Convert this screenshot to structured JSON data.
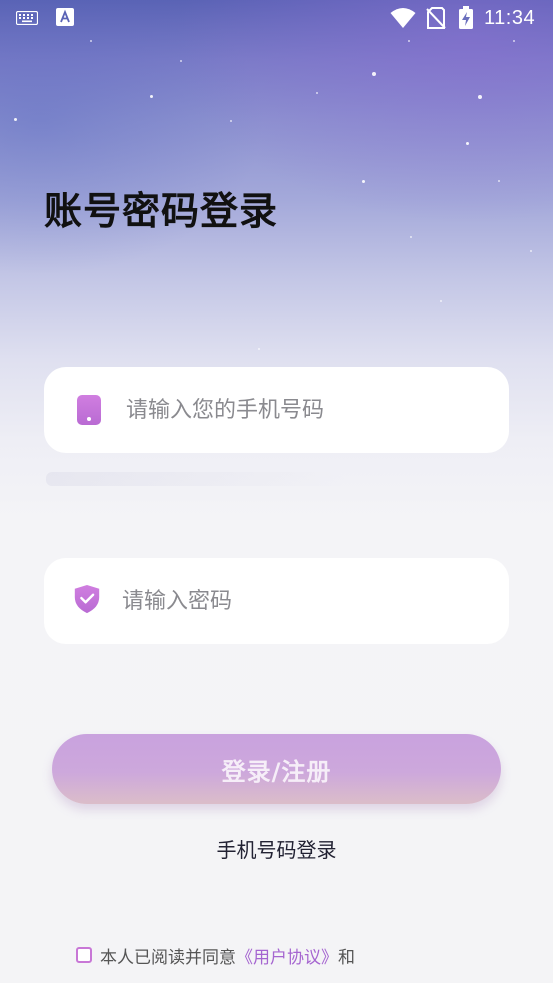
{
  "status_bar": {
    "time": "11:34"
  },
  "page": {
    "title": "账号密码登录"
  },
  "form": {
    "phone_placeholder": "请输入您的手机号码",
    "password_placeholder": "请输入密码",
    "submit_label": "登录/注册",
    "switch_link": "手机号码登录"
  },
  "agreement": {
    "prefix": "本人已阅读并同意",
    "user_agreement_link": "《用户协议》",
    "conjunction": "和"
  },
  "colors": {
    "accent": "#c877d6",
    "link": "#a565d0",
    "button_gradient_top": "#c9a2de",
    "button_gradient_bottom": "#dbbdc9"
  },
  "icons": {
    "phone_field": "phone-icon",
    "password_field": "shield-check-icon",
    "status_left_1": "keyboard-icon",
    "status_left_2": "a-icon",
    "status_wifi": "wifi-icon",
    "status_sim": "no-sim-icon",
    "status_battery": "battery-charging-icon"
  }
}
